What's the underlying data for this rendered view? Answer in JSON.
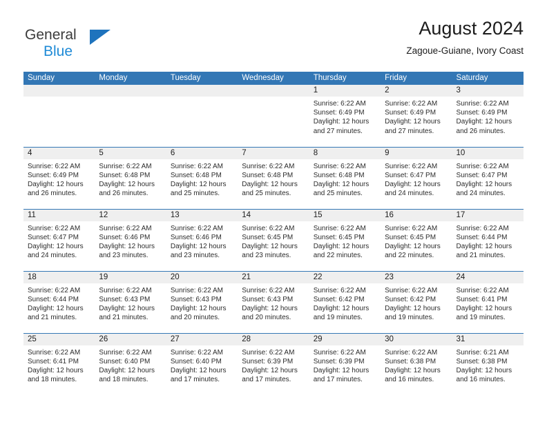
{
  "brand": {
    "name_top": "General",
    "name_bottom": "Blue",
    "triangle_color": "#1e73bd",
    "top_color": "#3b3b3b",
    "bottom_color": "#1e8ad6"
  },
  "header": {
    "title": "August 2024",
    "subtitle": "Zagoue-Guiane, Ivory Coast"
  },
  "theme": {
    "header_row_bg": "#3377b5",
    "header_row_text": "#ffffff",
    "day_strip_bg": "#efefef",
    "row_separator": "#3377b5"
  },
  "calendar": {
    "weekday_headers": [
      "Sunday",
      "Monday",
      "Tuesday",
      "Wednesday",
      "Thursday",
      "Friday",
      "Saturday"
    ],
    "weeks": [
      [
        {
          "day": "",
          "empty": true
        },
        {
          "day": "",
          "empty": true
        },
        {
          "day": "",
          "empty": true
        },
        {
          "day": "",
          "empty": true
        },
        {
          "day": "1",
          "sunrise": "Sunrise: 6:22 AM",
          "sunset": "Sunset: 6:49 PM",
          "daylight1": "Daylight: 12 hours",
          "daylight2": "and 27 minutes."
        },
        {
          "day": "2",
          "sunrise": "Sunrise: 6:22 AM",
          "sunset": "Sunset: 6:49 PM",
          "daylight1": "Daylight: 12 hours",
          "daylight2": "and 27 minutes."
        },
        {
          "day": "3",
          "sunrise": "Sunrise: 6:22 AM",
          "sunset": "Sunset: 6:49 PM",
          "daylight1": "Daylight: 12 hours",
          "daylight2": "and 26 minutes."
        }
      ],
      [
        {
          "day": "4",
          "sunrise": "Sunrise: 6:22 AM",
          "sunset": "Sunset: 6:49 PM",
          "daylight1": "Daylight: 12 hours",
          "daylight2": "and 26 minutes."
        },
        {
          "day": "5",
          "sunrise": "Sunrise: 6:22 AM",
          "sunset": "Sunset: 6:48 PM",
          "daylight1": "Daylight: 12 hours",
          "daylight2": "and 26 minutes."
        },
        {
          "day": "6",
          "sunrise": "Sunrise: 6:22 AM",
          "sunset": "Sunset: 6:48 PM",
          "daylight1": "Daylight: 12 hours",
          "daylight2": "and 25 minutes."
        },
        {
          "day": "7",
          "sunrise": "Sunrise: 6:22 AM",
          "sunset": "Sunset: 6:48 PM",
          "daylight1": "Daylight: 12 hours",
          "daylight2": "and 25 minutes."
        },
        {
          "day": "8",
          "sunrise": "Sunrise: 6:22 AM",
          "sunset": "Sunset: 6:48 PM",
          "daylight1": "Daylight: 12 hours",
          "daylight2": "and 25 minutes."
        },
        {
          "day": "9",
          "sunrise": "Sunrise: 6:22 AM",
          "sunset": "Sunset: 6:47 PM",
          "daylight1": "Daylight: 12 hours",
          "daylight2": "and 24 minutes."
        },
        {
          "day": "10",
          "sunrise": "Sunrise: 6:22 AM",
          "sunset": "Sunset: 6:47 PM",
          "daylight1": "Daylight: 12 hours",
          "daylight2": "and 24 minutes."
        }
      ],
      [
        {
          "day": "11",
          "sunrise": "Sunrise: 6:22 AM",
          "sunset": "Sunset: 6:47 PM",
          "daylight1": "Daylight: 12 hours",
          "daylight2": "and 24 minutes."
        },
        {
          "day": "12",
          "sunrise": "Sunrise: 6:22 AM",
          "sunset": "Sunset: 6:46 PM",
          "daylight1": "Daylight: 12 hours",
          "daylight2": "and 23 minutes."
        },
        {
          "day": "13",
          "sunrise": "Sunrise: 6:22 AM",
          "sunset": "Sunset: 6:46 PM",
          "daylight1": "Daylight: 12 hours",
          "daylight2": "and 23 minutes."
        },
        {
          "day": "14",
          "sunrise": "Sunrise: 6:22 AM",
          "sunset": "Sunset: 6:45 PM",
          "daylight1": "Daylight: 12 hours",
          "daylight2": "and 23 minutes."
        },
        {
          "day": "15",
          "sunrise": "Sunrise: 6:22 AM",
          "sunset": "Sunset: 6:45 PM",
          "daylight1": "Daylight: 12 hours",
          "daylight2": "and 22 minutes."
        },
        {
          "day": "16",
          "sunrise": "Sunrise: 6:22 AM",
          "sunset": "Sunset: 6:45 PM",
          "daylight1": "Daylight: 12 hours",
          "daylight2": "and 22 minutes."
        },
        {
          "day": "17",
          "sunrise": "Sunrise: 6:22 AM",
          "sunset": "Sunset: 6:44 PM",
          "daylight1": "Daylight: 12 hours",
          "daylight2": "and 21 minutes."
        }
      ],
      [
        {
          "day": "18",
          "sunrise": "Sunrise: 6:22 AM",
          "sunset": "Sunset: 6:44 PM",
          "daylight1": "Daylight: 12 hours",
          "daylight2": "and 21 minutes."
        },
        {
          "day": "19",
          "sunrise": "Sunrise: 6:22 AM",
          "sunset": "Sunset: 6:43 PM",
          "daylight1": "Daylight: 12 hours",
          "daylight2": "and 21 minutes."
        },
        {
          "day": "20",
          "sunrise": "Sunrise: 6:22 AM",
          "sunset": "Sunset: 6:43 PM",
          "daylight1": "Daylight: 12 hours",
          "daylight2": "and 20 minutes."
        },
        {
          "day": "21",
          "sunrise": "Sunrise: 6:22 AM",
          "sunset": "Sunset: 6:43 PM",
          "daylight1": "Daylight: 12 hours",
          "daylight2": "and 20 minutes."
        },
        {
          "day": "22",
          "sunrise": "Sunrise: 6:22 AM",
          "sunset": "Sunset: 6:42 PM",
          "daylight1": "Daylight: 12 hours",
          "daylight2": "and 19 minutes."
        },
        {
          "day": "23",
          "sunrise": "Sunrise: 6:22 AM",
          "sunset": "Sunset: 6:42 PM",
          "daylight1": "Daylight: 12 hours",
          "daylight2": "and 19 minutes."
        },
        {
          "day": "24",
          "sunrise": "Sunrise: 6:22 AM",
          "sunset": "Sunset: 6:41 PM",
          "daylight1": "Daylight: 12 hours",
          "daylight2": "and 19 minutes."
        }
      ],
      [
        {
          "day": "25",
          "sunrise": "Sunrise: 6:22 AM",
          "sunset": "Sunset: 6:41 PM",
          "daylight1": "Daylight: 12 hours",
          "daylight2": "and 18 minutes."
        },
        {
          "day": "26",
          "sunrise": "Sunrise: 6:22 AM",
          "sunset": "Sunset: 6:40 PM",
          "daylight1": "Daylight: 12 hours",
          "daylight2": "and 18 minutes."
        },
        {
          "day": "27",
          "sunrise": "Sunrise: 6:22 AM",
          "sunset": "Sunset: 6:40 PM",
          "daylight1": "Daylight: 12 hours",
          "daylight2": "and 17 minutes."
        },
        {
          "day": "28",
          "sunrise": "Sunrise: 6:22 AM",
          "sunset": "Sunset: 6:39 PM",
          "daylight1": "Daylight: 12 hours",
          "daylight2": "and 17 minutes."
        },
        {
          "day": "29",
          "sunrise": "Sunrise: 6:22 AM",
          "sunset": "Sunset: 6:39 PM",
          "daylight1": "Daylight: 12 hours",
          "daylight2": "and 17 minutes."
        },
        {
          "day": "30",
          "sunrise": "Sunrise: 6:22 AM",
          "sunset": "Sunset: 6:38 PM",
          "daylight1": "Daylight: 12 hours",
          "daylight2": "and 16 minutes."
        },
        {
          "day": "31",
          "sunrise": "Sunrise: 6:21 AM",
          "sunset": "Sunset: 6:38 PM",
          "daylight1": "Daylight: 12 hours",
          "daylight2": "and 16 minutes."
        }
      ]
    ]
  }
}
